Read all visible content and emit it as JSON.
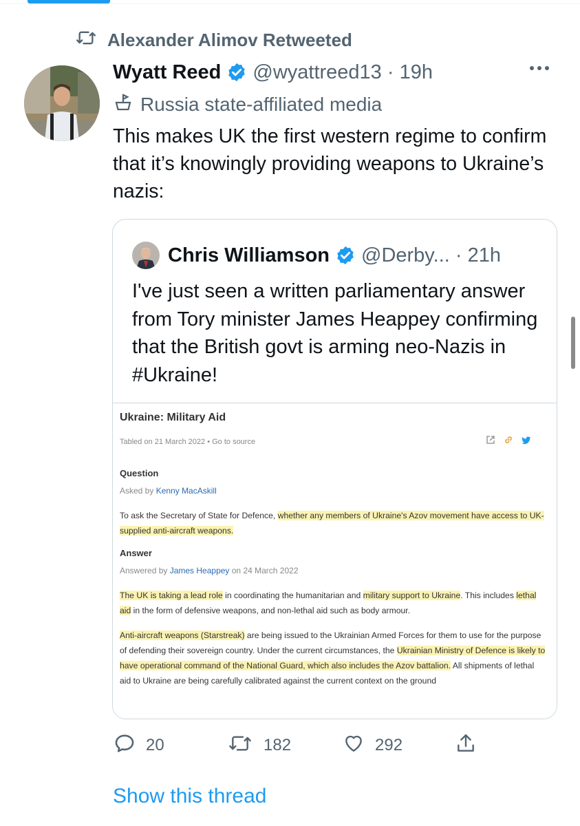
{
  "retweet_banner": {
    "text": "Alexander Alimov Retweeted"
  },
  "tweet": {
    "author_name": "Wyatt Reed",
    "handle_time": "@wyattreed13 · 19h",
    "label": "Russia state-affiliated media",
    "text": "This makes UK the first western regime to confirm that it’s knowingly providing weapons to Ukraine’s nazis:"
  },
  "quote": {
    "author_name": "Chris Williamson",
    "handle_time": "@Derby... · 21h",
    "text": "I've just seen a written parliamentary answer from Tory minister James Heappey confirming that the British govt is arming neo-Nazis in #Ukraine!",
    "document": {
      "title": "Ukraine: Military Aid",
      "meta": "Tabled on 21 March 2022 • Go to source",
      "question_heading": "Question",
      "asked_by_prefix": "Asked by ",
      "asked_by_name": "Kenny MacAskill",
      "question_text_a": "To ask the Secretary of State for Defence, ",
      "question_text_b": "whether any members of Ukraine's Azov movement have access to UK-supplied anti-aircraft weapons.",
      "answer_heading": "Answer",
      "answered_by_prefix": "Answered by ",
      "answered_by_name": "James Heappey",
      "answered_by_suffix": " on 24 March 2022",
      "para1_a": "The UK is taking a lead role",
      "para1_b": " in coordinating the humanitarian and ",
      "para1_c": "military support to Ukraine",
      "para1_d": ". This includes ",
      "para1_e": "lethal aid",
      "para1_f": " in the form of defensive weapons, and non-lethal aid such as body armour.",
      "para2_a": "Anti-aircraft weapons (Starstreak)",
      "para2_b": " are being issued to the Ukrainian Armed Forces for them to use for the purpose of defending their sovereign country. Under the current circumstances, the ",
      "para2_c": "Ukrainian Ministry of Defence is likely to have operational command of the National Guard, which also includes the Azov battalion.",
      "para2_d": " All shipments of lethal aid to Ukraine are being carefully calibrated against the current context on the ground"
    }
  },
  "actions": {
    "replies": "20",
    "retweets": "182",
    "likes": "292"
  },
  "show_thread": "Show this thread",
  "colors": {
    "accent": "#1d9bf0",
    "secondary_text": "#536471",
    "highlight": "#fbf3b2"
  }
}
